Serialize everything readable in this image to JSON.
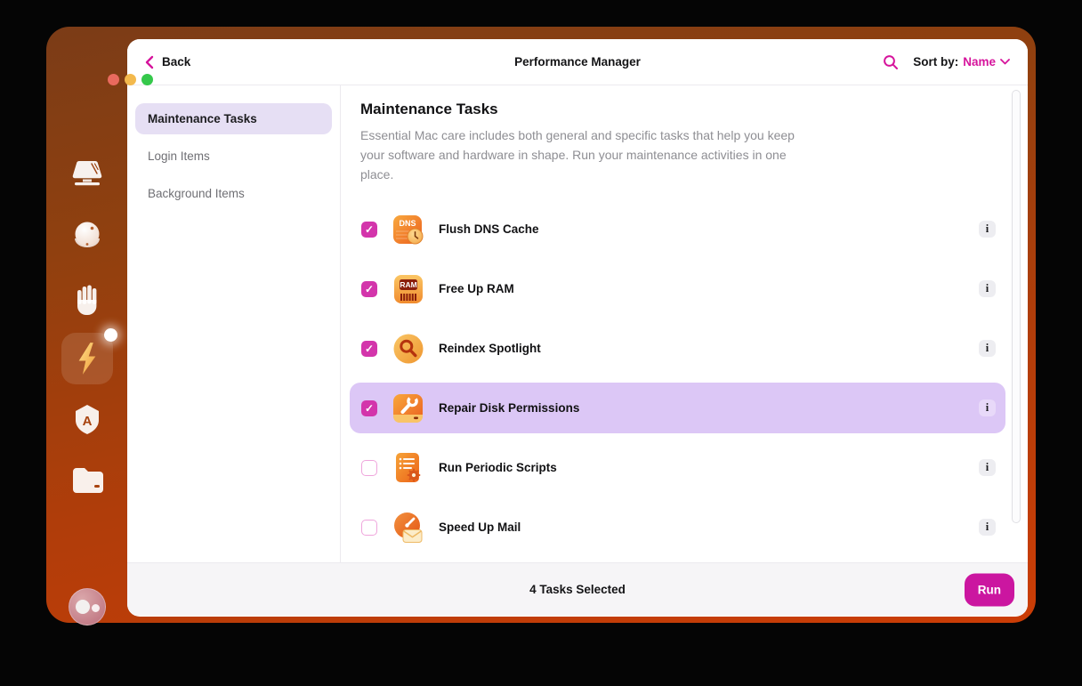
{
  "header": {
    "back_label": "Back",
    "title": "Performance Manager",
    "sort_by_label": "Sort by:",
    "sort_value": "Name"
  },
  "nav": {
    "items": [
      {
        "label": "Maintenance Tasks",
        "selected": true
      },
      {
        "label": "Login Items",
        "selected": false
      },
      {
        "label": "Background Items",
        "selected": false
      }
    ]
  },
  "content": {
    "heading": "Maintenance Tasks",
    "description": "Essential Mac care includes both general and specific tasks that help you keep your software and hardware in shape. Run your maintenance activities in one place.",
    "tasks": [
      {
        "label": "Flush DNS Cache",
        "checked": true,
        "highlighted": false,
        "icon": "dns-cache-icon"
      },
      {
        "label": "Free Up RAM",
        "checked": true,
        "highlighted": false,
        "icon": "ram-chip-icon"
      },
      {
        "label": "Reindex Spotlight",
        "checked": true,
        "highlighted": false,
        "icon": "spotlight-magnifier-icon"
      },
      {
        "label": "Repair Disk Permissions",
        "checked": true,
        "highlighted": true,
        "icon": "disk-wrench-icon"
      },
      {
        "label": "Run Periodic Scripts",
        "checked": false,
        "highlighted": false,
        "icon": "scripts-gear-icon"
      },
      {
        "label": "Speed Up Mail",
        "checked": false,
        "highlighted": false,
        "icon": "mail-speedometer-icon"
      }
    ]
  },
  "footer": {
    "status": "4 Tasks Selected",
    "run_label": "Run"
  },
  "dock": {
    "icons": [
      "mac-display-icon",
      "cleanup-orb-icon",
      "protection-hand-icon",
      "speed-lightning-icon",
      "applications-icon",
      "files-folder-icon",
      "assistant-avatar-icon"
    ],
    "selected": "speed-lightning-icon"
  },
  "icon_text": {
    "dns": "DNS",
    "ram": "RAM",
    "app_letter": "A",
    "info_glyph": "i"
  },
  "colors": {
    "accent_magenta": "#d6149c",
    "run_button": "#cb16a0",
    "checkbox_checked": "#d335ab",
    "row_highlight": "#dcc7f6",
    "nav_selected_bg": "#e6dff4",
    "window_frame_top": "#7b3c17",
    "window_frame_bottom": "#cb3d06",
    "footer_bg": "#f6f5f7",
    "traffic_red": "#e96a5e",
    "traffic_yellow": "#f3b94d",
    "traffic_green": "#35c84b"
  }
}
